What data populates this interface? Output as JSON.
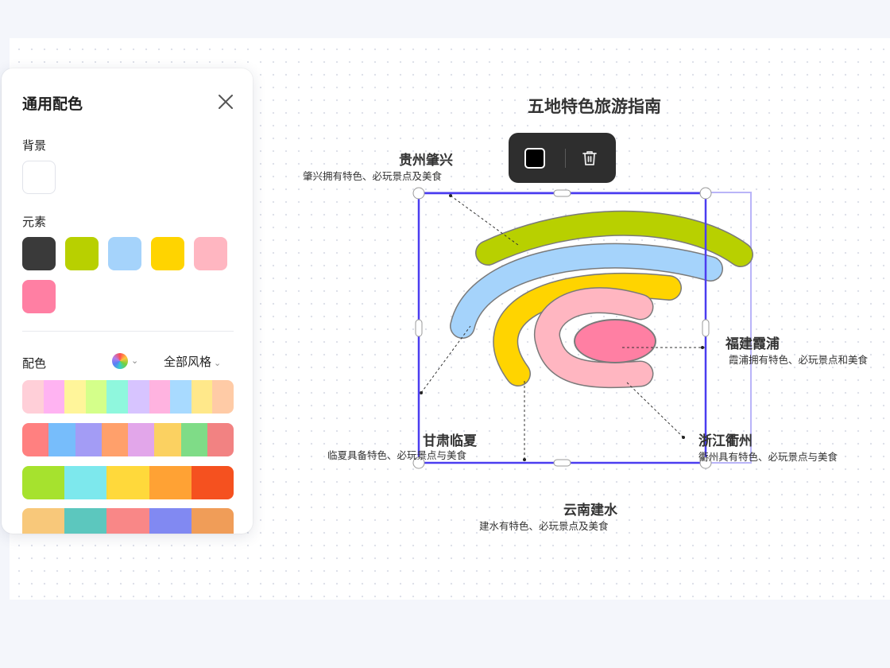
{
  "panel": {
    "title": "通用配色",
    "background_label": "背景",
    "background_color": "#ffffff",
    "elements_label": "元素",
    "element_colors": [
      "#3a3a3a",
      "#b8d000",
      "#a5d3fb",
      "#ffd400",
      "#ffb6c1",
      "#ff7fa3"
    ],
    "palette_label": "配色",
    "style_select": "全部风格",
    "palettes": [
      [
        "#ffcfd8",
        "#ffb3f2",
        "#fff59a",
        "#d4ff8a",
        "#8ff7dd",
        "#d7c4ff",
        "#ffb3e0",
        "#a8daff",
        "#ffe88a",
        "#ffcba6"
      ],
      [
        "#ff8080",
        "#77bdfb",
        "#a39cf5",
        "#ffa06b",
        "#e2a6ea",
        "#fbd161",
        "#7fdc87",
        "#f28282"
      ],
      [
        "#a6e22e",
        "#7de8ed",
        "#ffd93b",
        "#ffa234",
        "#f5511f"
      ],
      [
        "#f8c87a",
        "#5cc7be",
        "#f98787",
        "#8189f2",
        "#f09d58"
      ]
    ]
  },
  "canvas": {
    "title": "五地特色旅游指南",
    "labels": [
      {
        "title": "贵州肇兴",
        "desc": "肇兴拥有特色、必玩景点及美食"
      },
      {
        "title": "福建霞浦",
        "desc": "霞浦拥有特色、必玩景点和美食"
      },
      {
        "title": "甘肃临夏",
        "desc": "临夏具备特色、必玩景点与美食"
      },
      {
        "title": "浙江衢州",
        "desc": "衢州具有特色、必玩景点与美食"
      },
      {
        "title": "云南建水",
        "desc": "建水有特色、必玩景点及美食"
      }
    ],
    "arc_colors": [
      "#b8d000",
      "#a5d3fb",
      "#ffd400",
      "#ffb6c1",
      "#ff7fa3"
    ],
    "selection_color": "#4b3df0"
  },
  "toolbar": {
    "fill_color": "#000000"
  }
}
